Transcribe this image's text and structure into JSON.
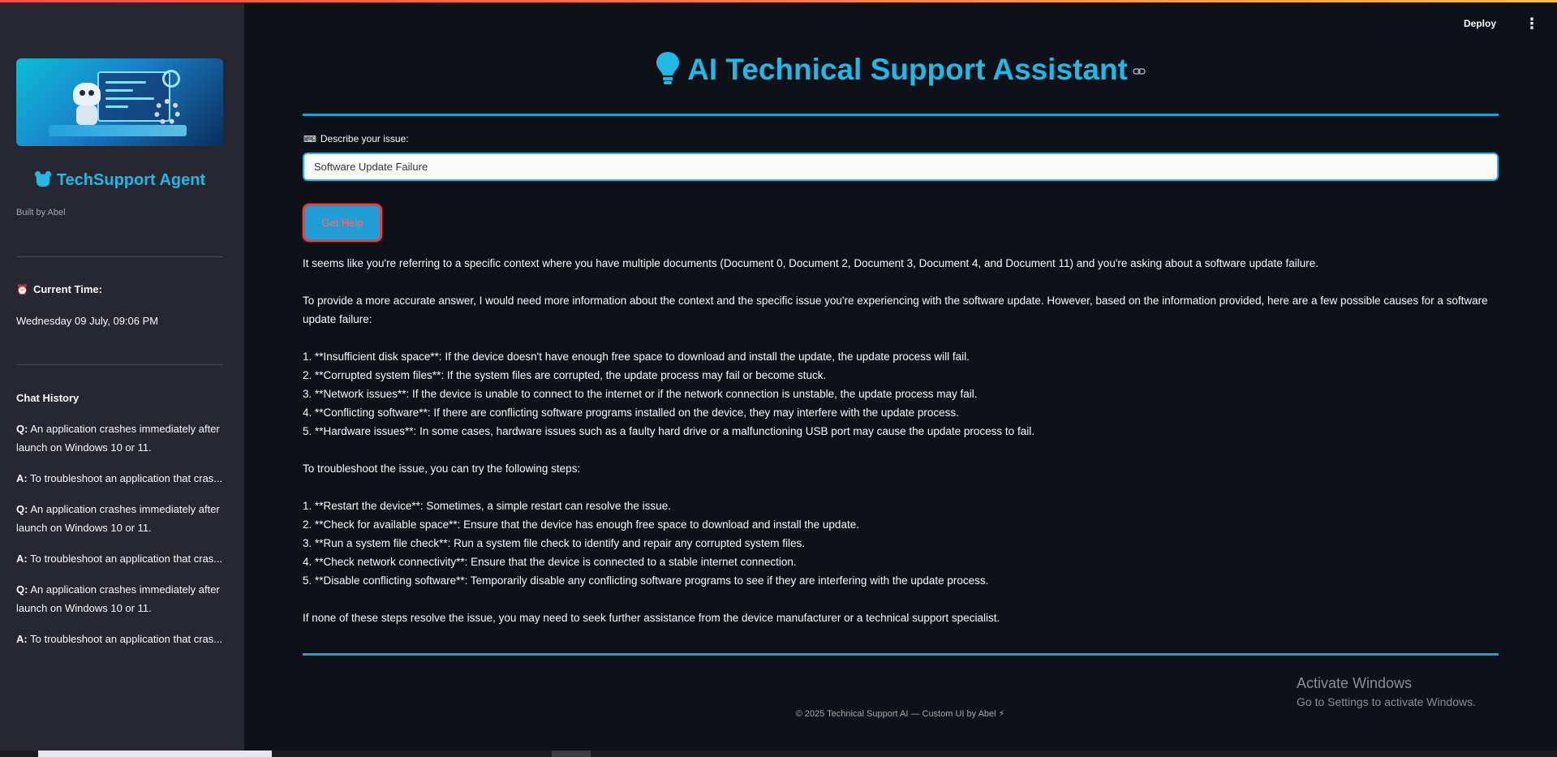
{
  "sidebar": {
    "agent_title": "TechSupport Agent",
    "built_by": "Built by Abel",
    "time_label": "Current Time:",
    "time_value": "Wednesday 09 July, 09:06 PM",
    "history_title": "Chat History",
    "history": [
      {
        "prefix": "Q:",
        "text": "An application crashes immediately after launch on Windows 10 or 11."
      },
      {
        "prefix": "A:",
        "text": "To troubleshoot an application that cras..."
      },
      {
        "prefix": "Q:",
        "text": "An application crashes immediately after launch on Windows 10 or 11."
      },
      {
        "prefix": "A:",
        "text": "To troubleshoot an application that cras..."
      },
      {
        "prefix": "Q:",
        "text": "An application crashes immediately after launch on Windows 10 or 11."
      },
      {
        "prefix": "A:",
        "text": "To troubleshoot an application that cras..."
      }
    ]
  },
  "header": {
    "deploy_label": "Deploy",
    "title": "AI Technical Support Assistant"
  },
  "form": {
    "label": "Describe your issue:",
    "input_value": "Software Update Failure",
    "button_label": "Get Help"
  },
  "answer": {
    "intro": "It seems like you're referring to a specific context where you have multiple documents (Document 0, Document 2, Document 3, Document 4, and Document 11) and you're asking about a software update failure.",
    "context": "To provide a more accurate answer, I would need more information about the context and the specific issue you're experiencing with the software update. However, based on the information provided, here are a few possible causes for a software update failure:",
    "causes": [
      "1. **Insufficient disk space**: If the device doesn't have enough free space to download and install the update, the update process will fail.",
      "2. **Corrupted system files**: If the system files are corrupted, the update process may fail or become stuck.",
      "3. **Network issues**: If the device is unable to connect to the internet or if the network connection is unstable, the update process may fail.",
      "4. **Conflicting software**: If there are conflicting software programs installed on the device, they may interfere with the update process.",
      "5. **Hardware issues**: In some cases, hardware issues such as a faulty hard drive or a malfunctioning USB port may cause the update process to fail."
    ],
    "steps_intro": "To troubleshoot the issue, you can try the following steps:",
    "steps": [
      "1. **Restart the device**: Sometimes, a simple restart can resolve the issue.",
      "2. **Check for available space**: Ensure that the device has enough free space to download and install the update.",
      "3. **Run a system file check**: Run a system file check to identify and repair any corrupted system files.",
      "4. **Check network connectivity**: Ensure that the device is connected to a stable internet connection.",
      "5. **Disable conflicting software**: Temporarily disable any conflicting software programs to see if they are interfering with the update process."
    ],
    "closing": "If none of these steps resolve the issue, you may need to seek further assistance from the device manufacturer or a technical support specialist."
  },
  "footer": {
    "text": "© 2025 Technical Support AI — Custom UI by Abel ⚡"
  },
  "watermark": {
    "line1": "Activate Windows",
    "line2": "Go to Settings to activate Windows."
  },
  "colors": {
    "accent": "#21b8e6",
    "background": "#0e1117",
    "sidebar": "#262730",
    "button_border": "#e04444"
  }
}
